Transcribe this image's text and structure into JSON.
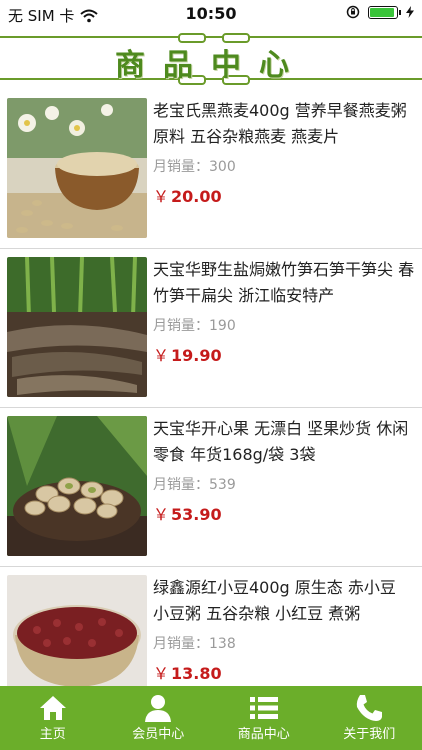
{
  "status": {
    "carrier": "无 SIM 卡",
    "time": "10:50"
  },
  "header": {
    "title": "商品中心"
  },
  "products": [
    {
      "name": "老宝氏黑燕麦400g 营养早餐燕麦粥原料 五谷杂粮燕麦 燕麦片",
      "sales_label": "月销量：",
      "sales": "300",
      "currency": "￥",
      "price": "20.00",
      "image": "oats-photo"
    },
    {
      "name": "天宝华野生盐焗嫩竹笋石笋干笋尖 春竹笋干扁尖 浙江临安特产",
      "sales_label": "月销量：",
      "sales": "190",
      "currency": "￥",
      "price": "19.90",
      "image": "bamboo-shoot-photo"
    },
    {
      "name": "天宝华开心果 无漂白 坚果炒货 休闲零食 年货168g/袋 3袋",
      "sales_label": "月销量：",
      "sales": "539",
      "currency": "￥",
      "price": "53.90",
      "image": "pistachio-photo"
    },
    {
      "name": "绿鑫源红小豆400g 原生态 赤小豆 小豆粥 五谷杂粮 小红豆 煮粥",
      "sales_label": "月销量：",
      "sales": "138",
      "currency": "￥",
      "price": "13.80",
      "image": "red-bean-photo"
    }
  ],
  "tabs": [
    {
      "label": "主页",
      "icon": "home-icon"
    },
    {
      "label": "会员中心",
      "icon": "user-icon"
    },
    {
      "label": "商品中心",
      "icon": "list-icon"
    },
    {
      "label": "关于我们",
      "icon": "phone-icon"
    }
  ],
  "colors": {
    "accent": "#6bae2a",
    "price": "#c51b1b",
    "title": "#4e8a1e"
  }
}
